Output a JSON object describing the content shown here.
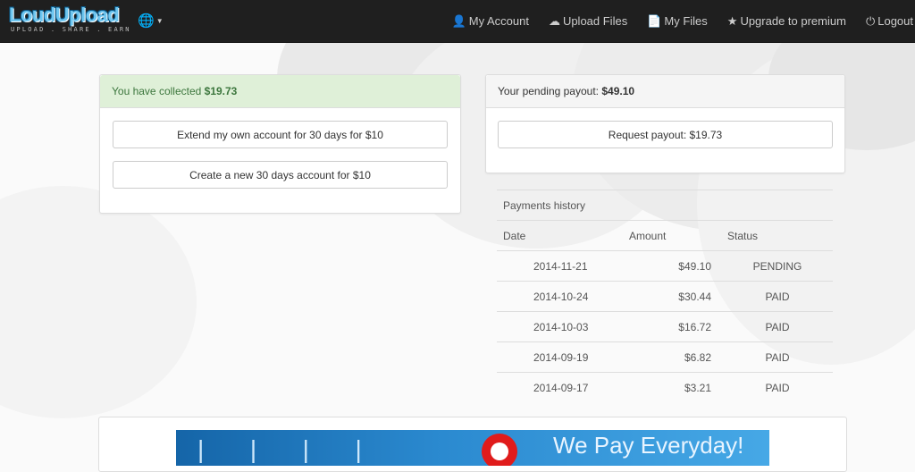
{
  "header": {
    "logo_text": "LoudUpload",
    "logo_tagline": "UPLOAD . SHARE . EARN",
    "nav": [
      {
        "label": "My Account",
        "icon": "user-icon"
      },
      {
        "label": "Upload Files",
        "icon": "cloud-upload-icon"
      },
      {
        "label": "My Files",
        "icon": "file-icon"
      },
      {
        "label": "Upgrade to premium",
        "icon": "star-icon"
      },
      {
        "label": "Logout",
        "icon": "power-icon"
      }
    ]
  },
  "collected": {
    "prefix": "You have collected",
    "amount": "$19.73",
    "extend_button": "Extend my own account for 30 days for $10",
    "create_button": "Create a new 30 days account for $10"
  },
  "payout": {
    "prefix": "Your pending payout:",
    "amount": "$49.10",
    "request_button": "Request payout: $19.73"
  },
  "history": {
    "title": "Payments history",
    "columns": [
      "Date",
      "Amount",
      "Status"
    ],
    "rows": [
      {
        "date": "2014-11-21",
        "amount": "$49.10",
        "status": "PENDING"
      },
      {
        "date": "2014-10-24",
        "amount": "$30.44",
        "status": "PAID"
      },
      {
        "date": "2014-10-03",
        "amount": "$16.72",
        "status": "PAID"
      },
      {
        "date": "2014-09-19",
        "amount": "$6.82",
        "status": "PAID"
      },
      {
        "date": "2014-09-17",
        "amount": "$3.21",
        "status": "PAID"
      }
    ]
  },
  "banner": {
    "text": "We Pay Everyday!"
  },
  "colors": {
    "topbar": "#1f1f1f",
    "success_bg": "#dff0d8",
    "success_text": "#3c763d",
    "banner_blue": "#2b8ad0"
  }
}
